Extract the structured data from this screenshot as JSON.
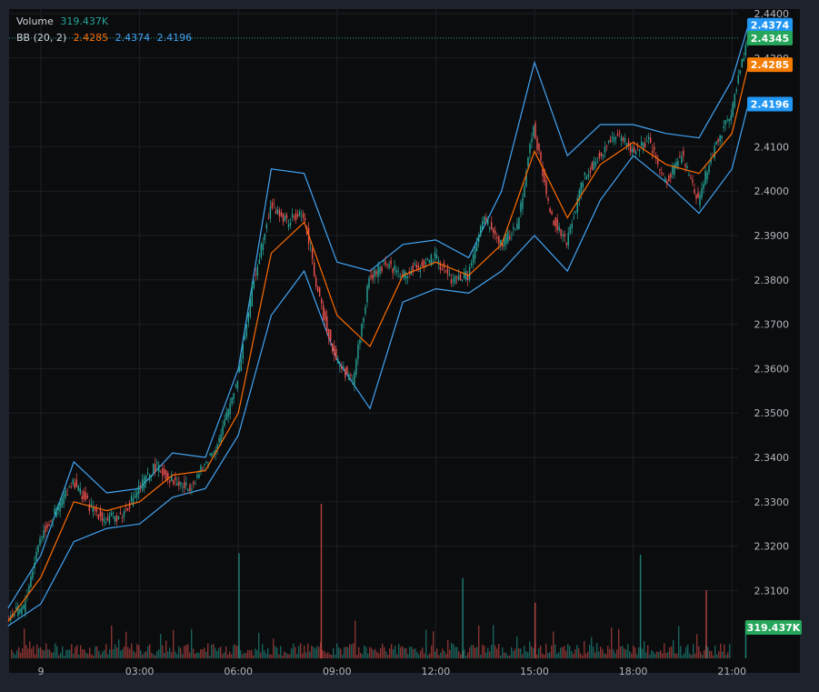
{
  "legend": {
    "volume": {
      "label": "Volume",
      "value": "319.437K"
    },
    "bb": {
      "label": "BB (20, 2)",
      "basis": "2.4285",
      "upper": "2.4374",
      "lower": "2.4196"
    }
  },
  "colors": {
    "bg": "#0b0c0e",
    "frame": "#1e222d",
    "grid": "#1c1f25",
    "up": "#26a69a",
    "down": "#ef5350",
    "bb_band": "#2962ff",
    "bb_line": "#42a5f5",
    "basis": "#ff6d00",
    "tick_text": "#b2b5be"
  },
  "badges": [
    {
      "text": "2.4374",
      "value": 2.4374,
      "color": "#2196f3"
    },
    {
      "text": "2.4345",
      "value": 2.4345,
      "color": "#26a65b"
    },
    {
      "text": "2.4285",
      "value": 2.4285,
      "color": "#f57c00"
    },
    {
      "text": "2.4196",
      "value": 2.4196,
      "color": "#2196f3"
    },
    {
      "text": "319.437K",
      "value": null,
      "color": "#26a65b"
    }
  ],
  "chart_data": {
    "type": "line",
    "title": "",
    "y_axis": {
      "range": [
        2.3,
        2.44
      ],
      "ticks": [
        "2.4400",
        "2.4300",
        "2.4200",
        "2.4100",
        "2.4000",
        "2.3900",
        "2.3800",
        "2.3700",
        "2.3600",
        "2.3500",
        "2.3400",
        "2.3300",
        "2.3200",
        "2.3100"
      ],
      "tick_values": [
        2.44,
        2.43,
        2.42,
        2.41,
        2.4,
        2.39,
        2.38,
        2.37,
        2.36,
        2.35,
        2.34,
        2.33,
        2.32,
        2.31
      ]
    },
    "x_axis": {
      "ticks": [
        "9",
        "03:00",
        "06:00",
        "09:00",
        "12:00",
        "15:00",
        "18:00",
        "21:00"
      ],
      "tick_hours": [
        0,
        3,
        6,
        9,
        12,
        15,
        18,
        21
      ],
      "range_hours": [
        -1.0,
        21.6
      ]
    },
    "last_close": 2.4345,
    "series": [
      {
        "name": "Price",
        "x_hours": [
          -1.0,
          -0.5,
          0,
          0.5,
          1.0,
          1.5,
          2.0,
          2.5,
          3.0,
          3.5,
          4.0,
          4.5,
          5.0,
          5.5,
          6.0,
          6.5,
          7.0,
          7.5,
          8.0,
          8.5,
          9.0,
          9.5,
          10.0,
          10.5,
          11.0,
          11.5,
          12.0,
          12.5,
          13.0,
          13.5,
          14.0,
          14.5,
          15.0,
          15.5,
          16.0,
          16.5,
          17.0,
          17.5,
          18.0,
          18.5,
          19.0,
          19.5,
          20.0,
          20.5,
          21.0,
          21.5
        ],
        "values": [
          2.304,
          2.306,
          2.322,
          2.328,
          2.335,
          2.329,
          2.326,
          2.327,
          2.333,
          2.338,
          2.335,
          2.333,
          2.338,
          2.345,
          2.358,
          2.38,
          2.397,
          2.393,
          2.395,
          2.375,
          2.362,
          2.357,
          2.38,
          2.384,
          2.381,
          2.383,
          2.385,
          2.38,
          2.381,
          2.394,
          2.388,
          2.392,
          2.415,
          2.395,
          2.388,
          2.403,
          2.408,
          2.413,
          2.409,
          2.411,
          2.402,
          2.408,
          2.398,
          2.41,
          2.418,
          2.4345
        ]
      },
      {
        "name": "BB Basis",
        "x_hours": [
          -1.0,
          0,
          1,
          2,
          3,
          4,
          5,
          6,
          7,
          8,
          9,
          10,
          11,
          12,
          13,
          14,
          15,
          16,
          17,
          18,
          19,
          20,
          21,
          21.5
        ],
        "values": [
          2.303,
          2.313,
          2.33,
          2.328,
          2.33,
          2.336,
          2.337,
          2.35,
          2.386,
          2.393,
          2.372,
          2.365,
          2.381,
          2.384,
          2.381,
          2.388,
          2.409,
          2.394,
          2.406,
          2.411,
          2.406,
          2.404,
          2.413,
          2.4285
        ]
      },
      {
        "name": "BB Upper",
        "x_hours": [
          -1.0,
          0,
          1,
          2,
          3,
          4,
          5,
          6,
          7,
          8,
          9,
          10,
          11,
          12,
          13,
          14,
          15,
          16,
          17,
          18,
          19,
          20,
          21,
          21.5
        ],
        "values": [
          2.306,
          2.318,
          2.339,
          2.332,
          2.333,
          2.341,
          2.34,
          2.36,
          2.405,
          2.404,
          2.384,
          2.382,
          2.388,
          2.389,
          2.385,
          2.4,
          2.429,
          2.408,
          2.415,
          2.415,
          2.413,
          2.412,
          2.425,
          2.4374
        ]
      },
      {
        "name": "BB Lower",
        "x_hours": [
          -1.0,
          0,
          1,
          2,
          3,
          4,
          5,
          6,
          7,
          8,
          9,
          10,
          11,
          12,
          13,
          14,
          15,
          16,
          17,
          18,
          19,
          20,
          21,
          21.5
        ],
        "values": [
          2.302,
          2.307,
          2.321,
          2.324,
          2.325,
          2.331,
          2.333,
          2.345,
          2.372,
          2.382,
          2.362,
          2.351,
          2.375,
          2.378,
          2.377,
          2.382,
          2.39,
          2.382,
          2.398,
          2.408,
          2.402,
          2.395,
          2.405,
          2.4196
        ]
      }
    ],
    "volume": {
      "last": "319.437K",
      "spike_hours": [
        6.0,
        8.5,
        12.8,
        15.0,
        18.2,
        20.2,
        21.4
      ],
      "spike_values": [
        0.68,
        1.0,
        0.52,
        0.36,
        0.67,
        0.44,
        0.24
      ]
    }
  }
}
